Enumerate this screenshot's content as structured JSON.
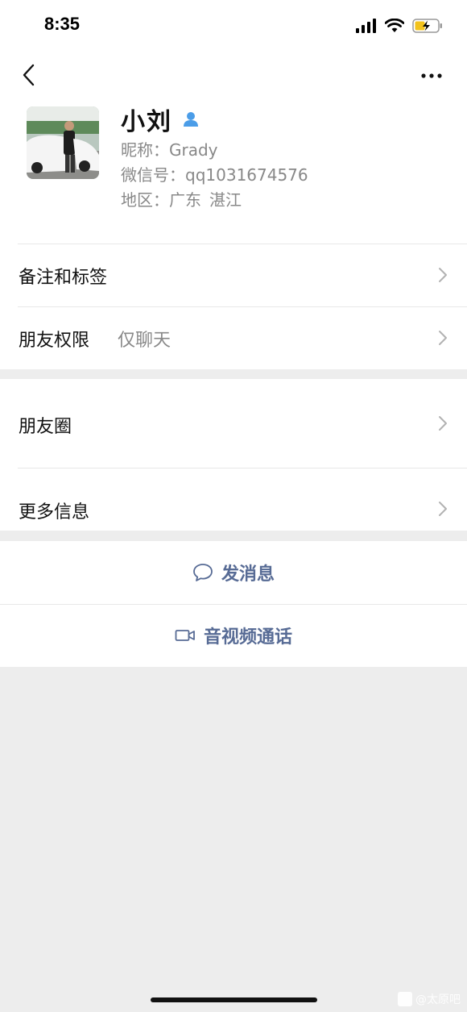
{
  "status_bar": {
    "time": "8:35",
    "icons": [
      "signal-icon",
      "wifi-icon",
      "battery-charging-icon"
    ]
  },
  "nav": {
    "back_icon": "chevron-left-icon",
    "more_icon": "ellipsis-icon"
  },
  "profile": {
    "name": "小刘",
    "gender_icon": "male-user-icon",
    "gender_color": "#4b9de8",
    "nickname": "昵称：Grady",
    "wechat_id": "微信号：qq1031674576",
    "region_label": "地区：广东",
    "region_city": "湛江"
  },
  "section1": {
    "items": [
      {
        "label": "备注和标签",
        "value": ""
      },
      {
        "label": "朋友权限",
        "value": "仅聊天"
      }
    ]
  },
  "section2": {
    "items": [
      {
        "label": "朋友圈"
      },
      {
        "label": "更多信息"
      }
    ]
  },
  "actions": {
    "send_message": "发消息",
    "av_call": "音视频通话",
    "accent_color": "#576b95"
  },
  "watermark": "@太原吧"
}
